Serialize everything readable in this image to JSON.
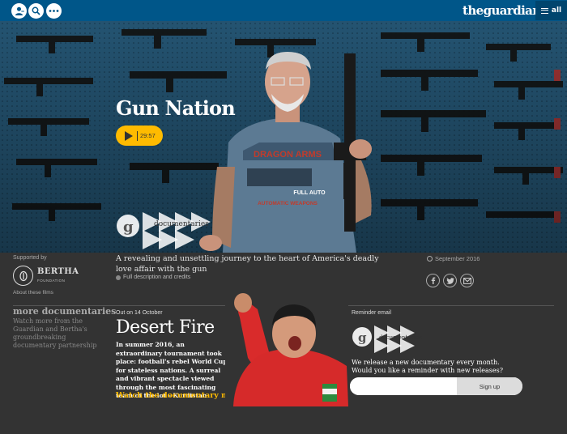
{
  "header": {
    "masthead": "theguardian",
    "menu_label": "all"
  },
  "hero": {
    "title": "Gun Nation",
    "duration": "29:57",
    "shirt_text_1": "DRAGON ARMS",
    "shirt_text_2": "FULL AUTO",
    "shirt_text_3": "AUTOMATIC WEAPONS",
    "series_logo": "documentaries"
  },
  "info": {
    "supported_by": "Supported by",
    "sponsor_name": "BERTHA",
    "sponsor_sub": "FOUNDATION",
    "about_link": "About these films",
    "standfirst": "A revealing and unsettling journey to the heart of America's deadly love affair with the gun",
    "full_description": "Full description and credits",
    "date": "September 2016"
  },
  "more": {
    "title": "more documentaries",
    "description": "Watch more from the Guardian and Bertha's groundbreaking documentary partnership"
  },
  "upcoming": {
    "out_on": "Out on 14 October",
    "title": "Desert Fire",
    "description": "In summer 2016, an extraordinary tournament took place: football's rebel World Cup for stateless nations. A surreal and vibrant spectacle viewed through the most fascinating team of the lot - Kurdistan",
    "watch_link": "Watch the documentary now"
  },
  "reminder": {
    "label": "Reminder email",
    "logo_text": "documentaries",
    "text": "We release a new documentary every month. Would you like a reminder with new releases?",
    "email_placeholder": "",
    "signup_label": "Sign up"
  },
  "icons": {
    "profile": "user-icon",
    "search": "search-icon",
    "more": "more-dots-icon",
    "menu": "hamburger-icon",
    "facebook": "facebook-icon",
    "twitter": "twitter-icon",
    "email": "mail-icon"
  },
  "colors": {
    "brand_blue": "#005689",
    "accent_yellow": "#ffbb00",
    "background": "#333333"
  }
}
